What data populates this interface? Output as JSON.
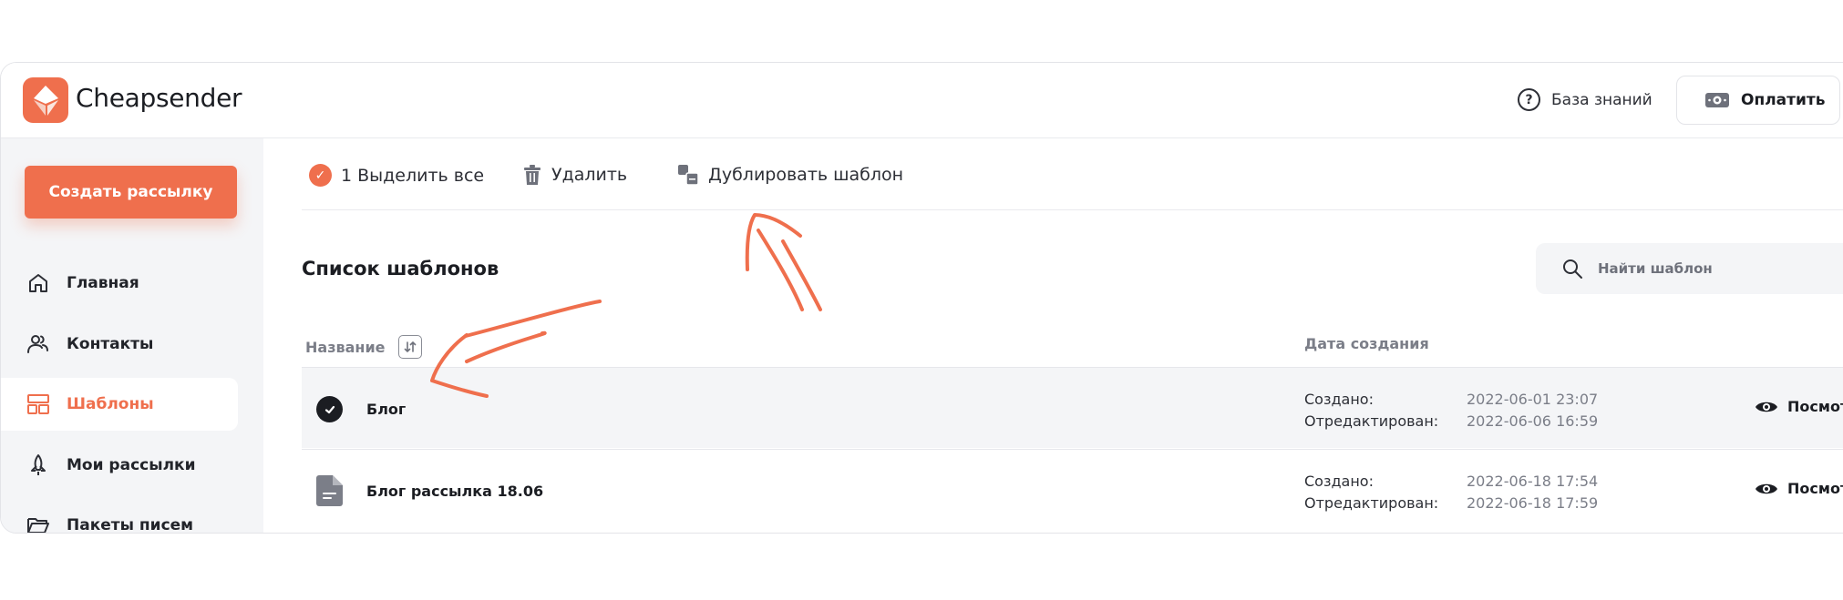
{
  "header": {
    "brand": "Cheapsender",
    "knowledge_base": "База знаний",
    "pay": "Оплатить"
  },
  "sidebar": {
    "create_button": "Создать рассылку",
    "items": [
      {
        "label": "Главная",
        "icon": "home-icon",
        "active": false
      },
      {
        "label": "Контакты",
        "icon": "contacts-icon",
        "active": false
      },
      {
        "label": "Шаблоны",
        "icon": "templates-icon",
        "active": true
      },
      {
        "label": "Мои рассылки",
        "icon": "rocket-icon",
        "active": false
      },
      {
        "label": "Пакеты писем",
        "icon": "folder-icon",
        "active": false
      }
    ]
  },
  "toolbar": {
    "select_count": "1",
    "select_all": "Выделить все",
    "delete": "Удалить",
    "duplicate": "Дублировать шаблон"
  },
  "list": {
    "title": "Список шаблонов",
    "search_placeholder": "Найти шаблон",
    "col_name": "Название",
    "col_date": "Дата создания",
    "created_label": "Создано:",
    "edited_label": "Отредактирован:",
    "view_label": "Посмотреть",
    "rows": [
      {
        "name": "Блог",
        "created": "2022-06-01 23:07",
        "edited": "2022-06-06 16:59",
        "selected": true
      },
      {
        "name": "Блог рассылка 18.06",
        "created": "2022-06-18 17:54",
        "edited": "2022-06-18 17:59",
        "selected": false
      }
    ]
  },
  "colors": {
    "accent": "#ef6f4d",
    "dark": "#1b1d22",
    "muted": "#7b7e88",
    "sidebar_bg": "#f4f5f7"
  }
}
